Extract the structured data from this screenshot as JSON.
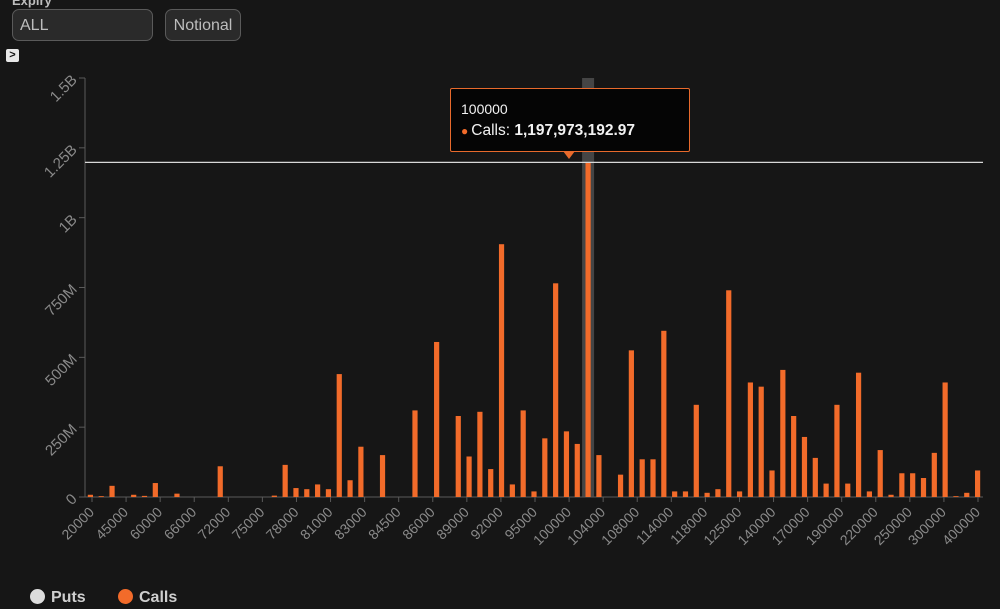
{
  "controls": {
    "expiry_label": "Expiry",
    "expiry_value": "ALL",
    "measure_button": "Notional",
    "expand_glyph": ">"
  },
  "tooltip": {
    "strike": "100000",
    "series": "Calls",
    "value": "1,197,973,192.97"
  },
  "colors": {
    "calls": "#f26b2a",
    "puts": "#dcdcdc",
    "background": "#161616",
    "highlight": "#555555"
  },
  "chart_data": {
    "type": "bar",
    "xlabel": "",
    "ylabel": "",
    "ylim": [
      0,
      1500000000
    ],
    "y_ticks": [
      {
        "value": 0,
        "label": "0"
      },
      {
        "value": 250000000,
        "label": "250M"
      },
      {
        "value": 500000000,
        "label": "500M"
      },
      {
        "value": 750000000,
        "label": "750M"
      },
      {
        "value": 1000000000,
        "label": "1B"
      },
      {
        "value": 1250000000,
        "label": "1.25B"
      },
      {
        "value": 1500000000,
        "label": "1.5B"
      }
    ],
    "x_tick_labels": [
      "20000",
      "45000",
      "60000",
      "66000",
      "72000",
      "75000",
      "78000",
      "81000",
      "83000",
      "84500",
      "86000",
      "89000",
      "92000",
      "95000",
      "100000",
      "104000",
      "108000",
      "114000",
      "118000",
      "125000",
      "140000",
      "170000",
      "190000",
      "220000",
      "250000",
      "300000",
      "400000"
    ],
    "reference_line": 1197973192.97,
    "highlight_category": "100000",
    "legend": [
      {
        "name": "Puts",
        "color": "#dcdcdc"
      },
      {
        "name": "Calls",
        "color": "#f26b2a"
      }
    ],
    "series": [
      {
        "name": "Calls",
        "color": "#f26b2a",
        "values": [
          8000000,
          3000000,
          40000000,
          0,
          8000000,
          4000000,
          50000000,
          0,
          12000000,
          0,
          0,
          0,
          110000000,
          0,
          0,
          0,
          0,
          5000000,
          115000000,
          32000000,
          28000000,
          45000000,
          28000000,
          440000000,
          60000000,
          180000000,
          0,
          150000000,
          0,
          0,
          310000000,
          0,
          555000000,
          0,
          290000000,
          145000000,
          305000000,
          100000000,
          905000000,
          45000000,
          310000000,
          20000000,
          210000000,
          765000000,
          235000000,
          190000000,
          1197973192.97,
          150000000,
          0,
          80000000,
          525000000,
          135000000,
          135000000,
          595000000,
          20000000,
          20000000,
          330000000,
          15000000,
          28000000,
          740000000,
          20000000,
          410000000,
          395000000,
          95000000,
          455000000,
          290000000,
          215000000,
          140000000,
          48000000,
          330000000,
          48000000,
          445000000,
          20000000,
          168000000,
          8000000,
          85000000,
          85000000,
          68000000,
          158000000,
          410000000,
          3000000,
          15000000,
          95000000
        ]
      }
    ]
  }
}
